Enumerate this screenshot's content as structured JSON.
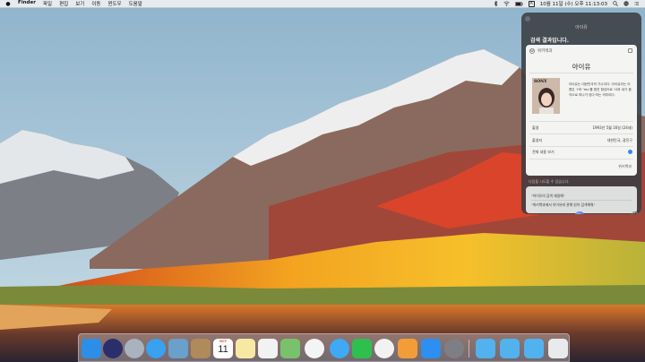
{
  "menubar": {
    "app_name": "Finder",
    "items": [
      "파일",
      "편집",
      "보기",
      "이동",
      "윈도우",
      "도움말"
    ],
    "clock": "10월 11일 (수) 오후 11:13:03",
    "input_source": "A"
  },
  "siri": {
    "query": "아이유",
    "result_title": "검색 결과입니다.",
    "card": {
      "source": "위키백과",
      "name": "아이유",
      "photo_brand": "SONY",
      "description": "아이유는 대한민국의 가수이다. 아이유라는 이름은 'I'와 'You'를 합친 합성어로 '너와 내가 음악으로 하나가 된다'라는 의미이다.",
      "rows": [
        {
          "label": "출생",
          "value": "1993년 5월 16일 (24세)"
        },
        {
          "label": "출생지",
          "value": "대한민국, 광진구"
        },
        {
          "label": "전체 내용 보기",
          "value": ""
        }
      ],
      "footer": "위키백과"
    },
    "try_label": "다음을 시도할 수 있습니다.",
    "suggestions": [
      "\"아이유의 검색 재생해\"",
      "\"위키백과에서 아이유에 관해 읽어 검색해줘\""
    ]
  },
  "dock": {
    "apps": [
      {
        "name": "Finder",
        "icon": "finder-icon",
        "color": "#2b8fe8"
      },
      {
        "name": "Siri",
        "icon": "siri-icon",
        "color": "#2a2f6c"
      },
      {
        "name": "Launchpad",
        "icon": "launchpad-icon",
        "color": "#a9b3bd"
      },
      {
        "name": "Safari",
        "icon": "safari-icon",
        "color": "#3aa0f0"
      },
      {
        "name": "Photos Preview",
        "icon": "preview-icon",
        "color": "#6aa0c9"
      },
      {
        "name": "Notes Book",
        "icon": "contacts-icon",
        "color": "#b08a5b"
      },
      {
        "name": "Calendar",
        "icon": "calendar-icon",
        "color": "#ffffff"
      },
      {
        "name": "Notes",
        "icon": "notes-icon",
        "color": "#f7e9a3"
      },
      {
        "name": "Reminders",
        "icon": "reminders-icon",
        "color": "#f2f2f2"
      },
      {
        "name": "Maps",
        "icon": "maps-icon",
        "color": "#79c26b"
      },
      {
        "name": "Photos",
        "icon": "photos-icon",
        "color": "#f4f4f4"
      },
      {
        "name": "Messages",
        "icon": "messages-icon",
        "color": "#3fa9f5"
      },
      {
        "name": "FaceTime",
        "icon": "facetime-icon",
        "color": "#2fbf4f"
      },
      {
        "name": "iTunes",
        "icon": "itunes-icon",
        "color": "#f2f2f2"
      },
      {
        "name": "iBooks",
        "icon": "ibooks-icon",
        "color": "#f29d38"
      },
      {
        "name": "App Store",
        "icon": "appstore-icon",
        "color": "#2d8ff0"
      },
      {
        "name": "System Preferences",
        "icon": "settings-icon",
        "color": "#7d7f84"
      },
      {
        "name": "Downloads Folder",
        "icon": "folder-icon",
        "color": "#52b2ee"
      },
      {
        "name": "Documents Folder",
        "icon": "folder-icon",
        "color": "#52b2ee"
      },
      {
        "name": "Screenshots Folder",
        "icon": "folder-icon",
        "color": "#52b2ee"
      },
      {
        "name": "Trash",
        "icon": "trash-icon",
        "color": "#e8eaec"
      }
    ],
    "calendar": {
      "month": "OCT",
      "day": "11"
    }
  }
}
